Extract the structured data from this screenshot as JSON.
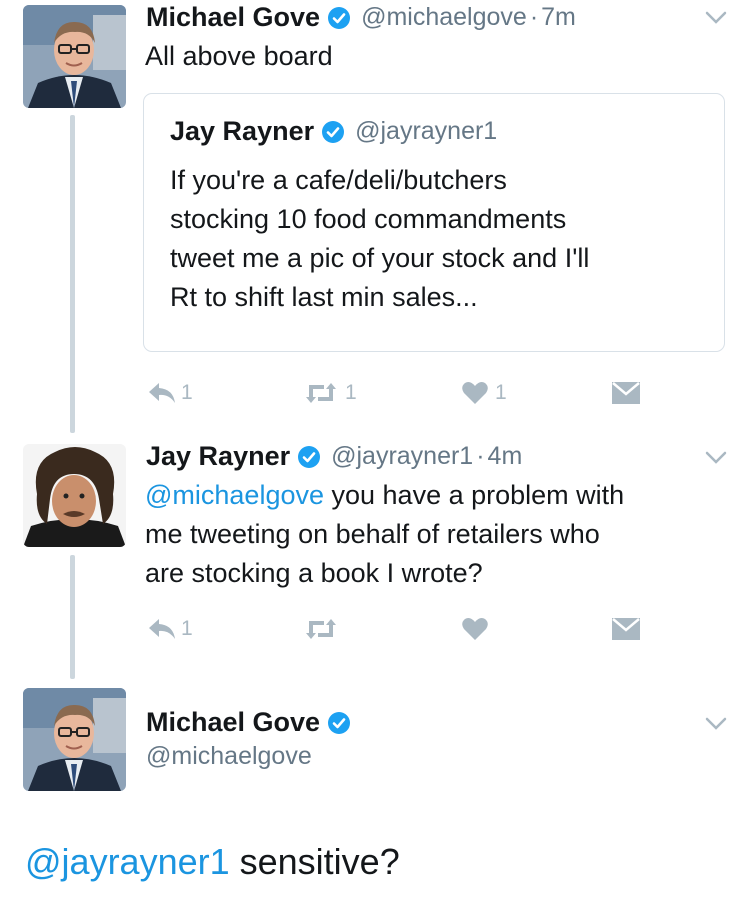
{
  "tweets": [
    {
      "name": "Michael Gove",
      "handle": "@michaelgove",
      "time": "7m",
      "text": "All above board",
      "quote": {
        "name": "Jay Rayner",
        "handle": "@jayrayner1",
        "lines": [
          "If you're a cafe/deli/butchers",
          "stocking 10 food commandments",
          "tweet me a pic of your stock and I'll",
          "Rt to shift last min sales..."
        ]
      },
      "reply_count": "1",
      "retweet_count": "1",
      "like_count": "1"
    },
    {
      "name": "Jay Rayner",
      "handle": "@jayrayner1",
      "time": "4m",
      "mention": "@michaelgove",
      "line1_rest": " you have a problem with",
      "line2": "me tweeting on behalf of retailers who",
      "line3": "are stocking a book I wrote?",
      "reply_count": "1"
    },
    {
      "name": "Michael Gove",
      "handle": "@michaelgove",
      "mention": "@jayrayner1",
      "text_rest": " sensitive?"
    }
  ],
  "time_separator": "·",
  "colors": {
    "link": "#1b95e0",
    "secondary": "#657786",
    "icon": "#aab8c2",
    "verified": "#1da1f2",
    "thread_line": "#ccd6dd"
  },
  "icons": [
    "verified-badge-icon",
    "chevron-down-icon",
    "reply-icon",
    "retweet-icon",
    "heart-icon",
    "direct-message-icon"
  ]
}
